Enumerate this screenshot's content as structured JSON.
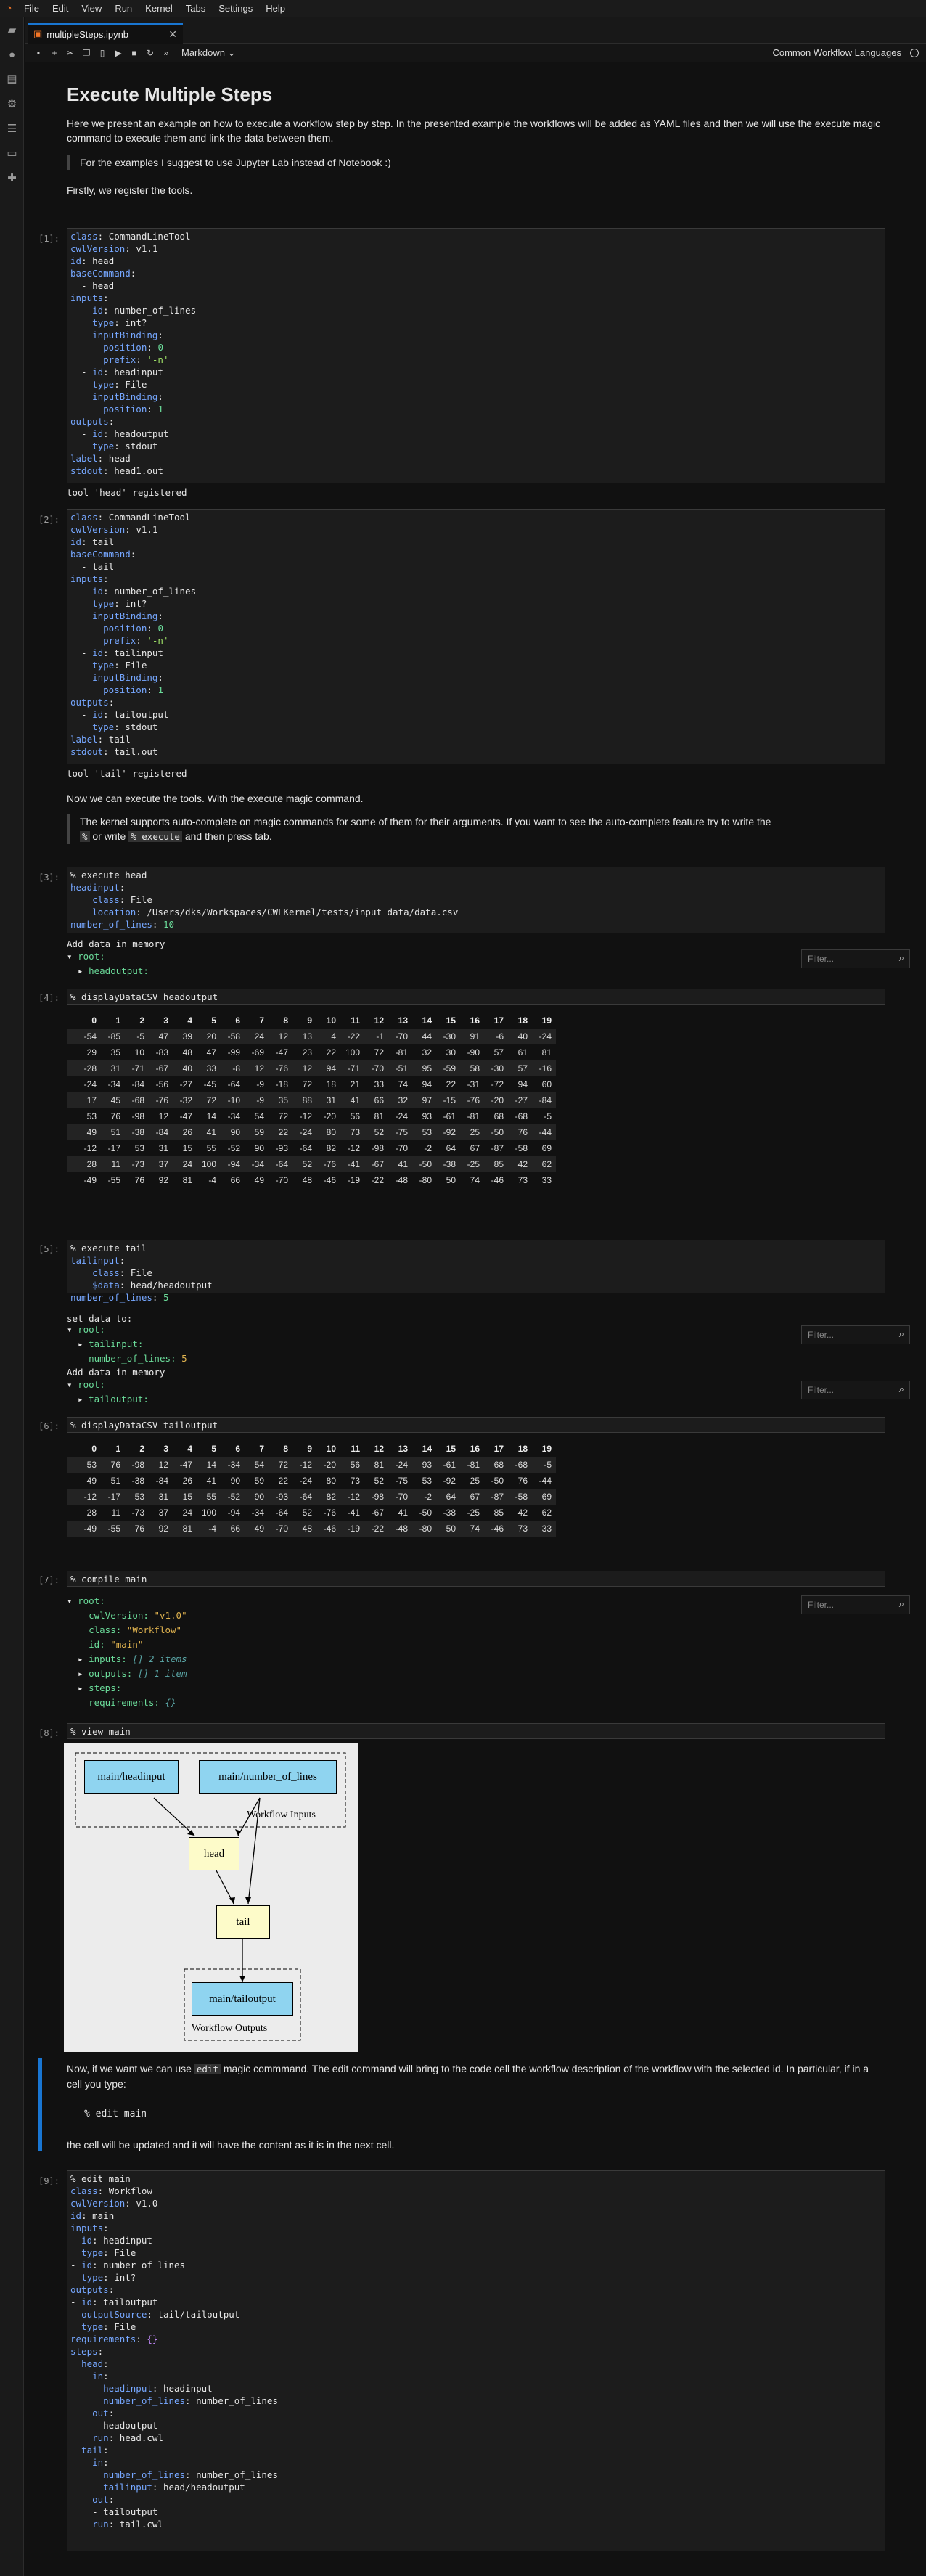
{
  "menubar": {
    "items": [
      "File",
      "Edit",
      "View",
      "Run",
      "Kernel",
      "Tabs",
      "Settings",
      "Help"
    ]
  },
  "tab": {
    "title": "multipleSteps.ipynb"
  },
  "toolbar": {
    "cell_type": "Markdown",
    "kernel_name": "Common Workflow Languages"
  },
  "md1": {
    "title": "Execute Multiple Steps",
    "p1": "Here we present an example on how to execute a workflow step by step. In the presented example the workflows will be added as YAML files and then we will use the execute magic command to execute them and link the data between them.",
    "quote": "For the examples I suggest to use Jupyter Lab instead of Notebook :)",
    "p2": "Firstly, we register the tools."
  },
  "cells": {
    "c1": {
      "prompt": "[1]:",
      "output": "tool 'head' registered"
    },
    "c2": {
      "prompt": "[2]:",
      "output": "tool 'tail' registered"
    },
    "c3": {
      "prompt": "[3]:",
      "output": "Add data in memory"
    },
    "c4": {
      "prompt": "[4]:"
    },
    "c5": {
      "prompt": "[5]:",
      "output1": "set data to:",
      "output2": "Add data in memory"
    },
    "c6": {
      "prompt": "[6]:"
    },
    "c7": {
      "prompt": "[7]:"
    },
    "c8": {
      "prompt": "[8]:"
    },
    "c9": {
      "prompt": "[9]:"
    }
  },
  "md2": {
    "p": "Now we can execute the tools. With the execute magic command.",
    "quote_a": "The kernel supports auto-complete on magic commands for some of them for their arguments. If you want to see the auto-complete feature try to write the",
    "quote_b": "%",
    "quote_c": "or write",
    "quote_d": "% execute",
    "quote_e": "and then press tab."
  },
  "md3": {
    "p_a": "Now, if we want we can use",
    "p_b": "edit",
    "p_c": "magic commmand. The edit command will bring to the code cell the workflow description of the workflow with the selected id. In particular, if in a cell you type:",
    "code": "% edit main",
    "p2": "the cell will be updated and it will have the content as it is in the next cell."
  },
  "filter": {
    "placeholder": "Filter..."
  },
  "trees": {
    "t3": {
      "root": "root:",
      "child": "headoutput:"
    },
    "t5a": {
      "root": "root:",
      "child": "tailinput:",
      "leaf_k": "number_of_lines:",
      "leaf_v": "5"
    },
    "t5b": {
      "root": "root:",
      "child": "tailoutput:"
    },
    "t7": {
      "root": "root:",
      "l1k": "cwlVersion:",
      "l1v": "\"v1.0\"",
      "l2k": "class:",
      "l2v": "\"Workflow\"",
      "l3k": "id:",
      "l3v": "\"main\"",
      "l4k": "inputs:",
      "l4v": "[] 2 items",
      "l5k": "outputs:",
      "l5v": "[] 1 item",
      "l6k": "steps:",
      "l7k": "requirements:",
      "l7v": "{}"
    }
  },
  "table1": {
    "headers": [
      "",
      "0",
      "1",
      "2",
      "3",
      "4",
      "5",
      "6",
      "7",
      "8",
      "9",
      "10",
      "11",
      "12",
      "13",
      "14",
      "15",
      "16",
      "17",
      "18",
      "19"
    ],
    "rows": [
      [
        "",
        "-54",
        "-85",
        "-5",
        "47",
        "39",
        "20",
        "-58",
        "24",
        "12",
        "13",
        "4",
        "-22",
        "-1",
        "-70",
        "44",
        "-30",
        "91",
        "-6",
        "40",
        "-24"
      ],
      [
        "",
        "29",
        "35",
        "10",
        "-83",
        "48",
        "47",
        "-99",
        "-69",
        "-47",
        "23",
        "22",
        "100",
        "72",
        "-81",
        "32",
        "30",
        "-90",
        "57",
        "61",
        "81"
      ],
      [
        "",
        "-28",
        "31",
        "-71",
        "-67",
        "40",
        "33",
        "-8",
        "12",
        "-76",
        "12",
        "94",
        "-71",
        "-70",
        "-51",
        "95",
        "-59",
        "58",
        "-30",
        "57",
        "-16"
      ],
      [
        "",
        "-24",
        "-34",
        "-84",
        "-56",
        "-27",
        "-45",
        "-64",
        "-9",
        "-18",
        "72",
        "18",
        "21",
        "33",
        "74",
        "94",
        "22",
        "-31",
        "-72",
        "94",
        "60"
      ],
      [
        "",
        "17",
        "45",
        "-68",
        "-76",
        "-32",
        "72",
        "-10",
        "-9",
        "35",
        "88",
        "31",
        "41",
        "66",
        "32",
        "97",
        "-15",
        "-76",
        "-20",
        "-27",
        "-84"
      ],
      [
        "",
        "53",
        "76",
        "-98",
        "12",
        "-47",
        "14",
        "-34",
        "54",
        "72",
        "-12",
        "-20",
        "56",
        "81",
        "-24",
        "93",
        "-61",
        "-81",
        "68",
        "-68",
        "-5"
      ],
      [
        "",
        "49",
        "51",
        "-38",
        "-84",
        "26",
        "41",
        "90",
        "59",
        "22",
        "-24",
        "80",
        "73",
        "52",
        "-75",
        "53",
        "-92",
        "25",
        "-50",
        "76",
        "-44"
      ],
      [
        "",
        "-12",
        "-17",
        "53",
        "31",
        "15",
        "55",
        "-52",
        "90",
        "-93",
        "-64",
        "82",
        "-12",
        "-98",
        "-70",
        "-2",
        "64",
        "67",
        "-87",
        "-58",
        "69"
      ],
      [
        "",
        "28",
        "11",
        "-73",
        "37",
        "24",
        "100",
        "-94",
        "-34",
        "-64",
        "52",
        "-76",
        "-41",
        "-67",
        "41",
        "-50",
        "-38",
        "-25",
        "85",
        "42",
        "62"
      ],
      [
        "",
        "-49",
        "-55",
        "76",
        "92",
        "81",
        "-4",
        "66",
        "49",
        "-70",
        "48",
        "-46",
        "-19",
        "-22",
        "-48",
        "-80",
        "50",
        "74",
        "-46",
        "73",
        "33"
      ]
    ]
  },
  "table2": {
    "headers": [
      "",
      "0",
      "1",
      "2",
      "3",
      "4",
      "5",
      "6",
      "7",
      "8",
      "9",
      "10",
      "11",
      "12",
      "13",
      "14",
      "15",
      "16",
      "17",
      "18",
      "19"
    ],
    "rows": [
      [
        "",
        "53",
        "76",
        "-98",
        "12",
        "-47",
        "14",
        "-34",
        "54",
        "72",
        "-12",
        "-20",
        "56",
        "81",
        "-24",
        "93",
        "-61",
        "-81",
        "68",
        "-68",
        "-5"
      ],
      [
        "",
        "49",
        "51",
        "-38",
        "-84",
        "26",
        "41",
        "90",
        "59",
        "22",
        "-24",
        "80",
        "73",
        "52",
        "-75",
        "53",
        "-92",
        "25",
        "-50",
        "76",
        "-44"
      ],
      [
        "",
        "-12",
        "-17",
        "53",
        "31",
        "15",
        "55",
        "-52",
        "90",
        "-93",
        "-64",
        "82",
        "-12",
        "-98",
        "-70",
        "-2",
        "64",
        "67",
        "-87",
        "-58",
        "69"
      ],
      [
        "",
        "28",
        "11",
        "-73",
        "37",
        "24",
        "100",
        "-94",
        "-34",
        "-64",
        "52",
        "-76",
        "-41",
        "-67",
        "41",
        "-50",
        "-38",
        "-25",
        "85",
        "42",
        "62"
      ],
      [
        "",
        "-49",
        "-55",
        "76",
        "92",
        "81",
        "-4",
        "66",
        "49",
        "-70",
        "48",
        "-46",
        "-19",
        "-22",
        "-48",
        "-80",
        "50",
        "74",
        "-46",
        "73",
        "33"
      ]
    ]
  },
  "graph": {
    "n1": "main/headinput",
    "n2": "main/number_of_lines",
    "inputs_label": "Workflow Inputs",
    "n3": "head",
    "n4": "tail",
    "n5": "main/tailoutput",
    "outputs_label": "Workflow Outputs"
  }
}
